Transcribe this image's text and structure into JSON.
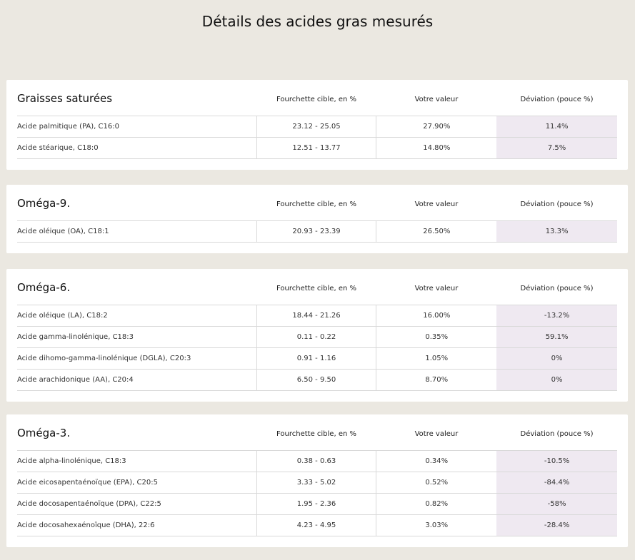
{
  "title": "Détails des acides gras mesurés",
  "columns": {
    "range": "Fourchette cible, en %",
    "value": "Votre valeur",
    "deviation": "Déviation (pouce %)"
  },
  "sections": [
    {
      "name": "Graisses saturées",
      "rows": [
        {
          "name": "Acide palmitique (PA), C16:0",
          "range": "23.12 - 25.05",
          "value": "27.90%",
          "deviation": "11.4%"
        },
        {
          "name": "Acide stéarique, C18:0",
          "range": "12.51 - 13.77",
          "value": "14.80%",
          "deviation": "7.5%"
        }
      ]
    },
    {
      "name": "Oméga-9.",
      "rows": [
        {
          "name": "Acide oléique (OA), C18:1",
          "range": "20.93 - 23.39",
          "value": "26.50%",
          "deviation": "13.3%"
        }
      ]
    },
    {
      "name": "Oméga-6.",
      "rows": [
        {
          "name": "Acide oléique (LA), C18:2",
          "range": "18.44 - 21.26",
          "value": "16.00%",
          "deviation": "-13.2%"
        },
        {
          "name": "Acide gamma-linolénique, C18:3",
          "range": "0.11 - 0.22",
          "value": "0.35%",
          "deviation": "59.1%"
        },
        {
          "name": "Acide dihomo-gamma-linolénique (DGLA), C20:3",
          "range": "0.91 - 1.16",
          "value": "1.05%",
          "deviation": "0%"
        },
        {
          "name": "Acide arachidonique (AA), C20:4",
          "range": "6.50 - 9.50",
          "value": "8.70%",
          "deviation": "0%"
        }
      ]
    },
    {
      "name": "Oméga-3.",
      "rows": [
        {
          "name": "Acide alpha-linolénique, C18:3",
          "range": "0.38 - 0.63",
          "value": "0.34%",
          "deviation": "-10.5%"
        },
        {
          "name": "Acide eicosapentaénoïque (EPA), C20:5",
          "range": "3.33 - 5.02",
          "value": "0.52%",
          "deviation": "-84.4%"
        },
        {
          "name": "Acide docosapentaénoïque (DPA), C22:5",
          "range": "1.95 - 2.36",
          "value": "0.82%",
          "deviation": "-58%"
        },
        {
          "name": "Acide docosahexaénoïque (DHA), 22:6",
          "range": "4.23 - 4.95",
          "value": "3.03%",
          "deviation": "-28.4%"
        }
      ]
    }
  ]
}
